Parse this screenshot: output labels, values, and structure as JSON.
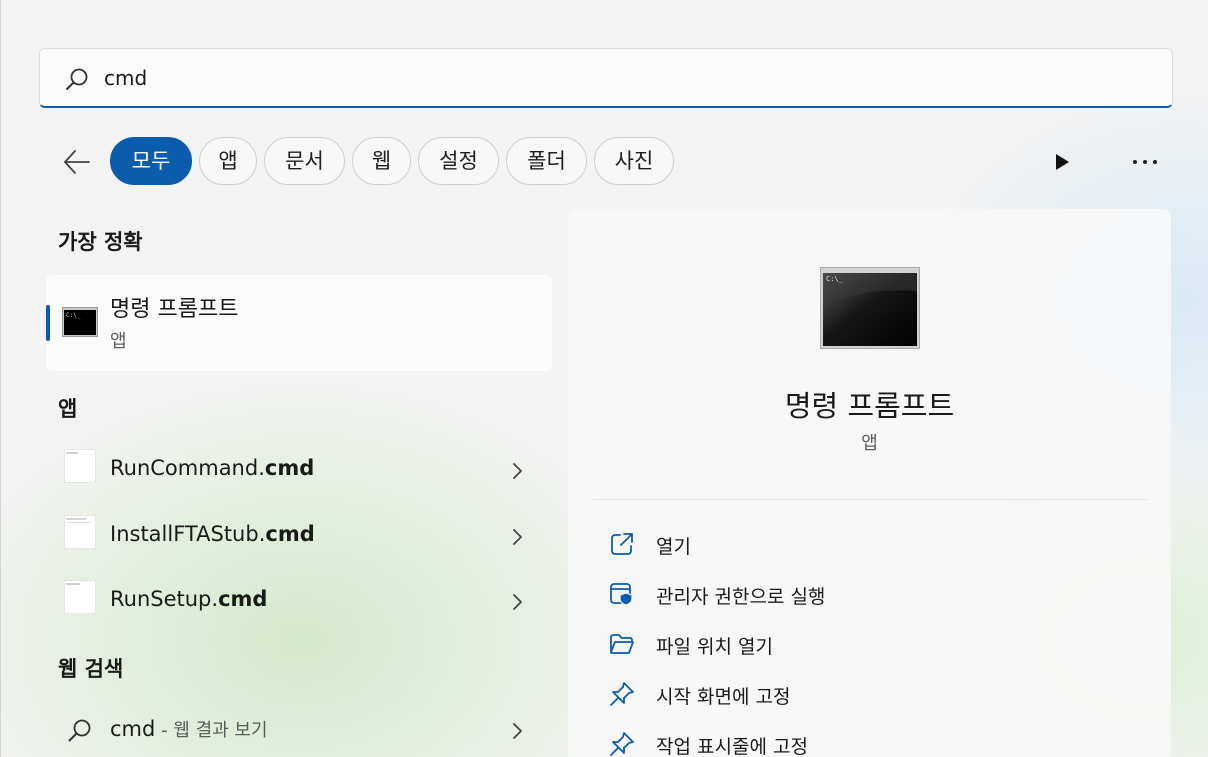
{
  "search": {
    "query": "cmd"
  },
  "filters": [
    {
      "label": "모두",
      "active": true
    },
    {
      "label": "앱"
    },
    {
      "label": "문서"
    },
    {
      "label": "웹"
    },
    {
      "label": "설정"
    },
    {
      "label": "폴더"
    },
    {
      "label": "사진"
    }
  ],
  "best_match": {
    "section_title": "가장 정확",
    "name": "명령 프롬프트",
    "kind": "앱"
  },
  "apps": {
    "section_title": "앱",
    "items": [
      {
        "prefix": "RunCommand.",
        "bold": "cmd"
      },
      {
        "prefix": "InstallFTAStub.",
        "bold": "cmd"
      },
      {
        "prefix": "RunSetup.",
        "bold": "cmd"
      }
    ]
  },
  "web": {
    "section_title": "웹 검색",
    "query": "cmd",
    "suffix": " - 웹 결과 보기"
  },
  "preview": {
    "title": "명령 프롬프트",
    "kind": "앱",
    "icon_caption": "C:\\_",
    "actions": [
      {
        "label": "열기",
        "icon": "open-external-icon"
      },
      {
        "label": "관리자 권한으로 실행",
        "icon": "shield-admin-icon"
      },
      {
        "label": "파일 위치 열기",
        "icon": "folder-icon"
      },
      {
        "label": "시작 화면에 고정",
        "icon": "pin-icon"
      },
      {
        "label": "작업 표시줄에 고정",
        "icon": "pin-icon"
      }
    ]
  },
  "colors": {
    "accent": "#0b5cad",
    "background": "#f3f3f3"
  }
}
